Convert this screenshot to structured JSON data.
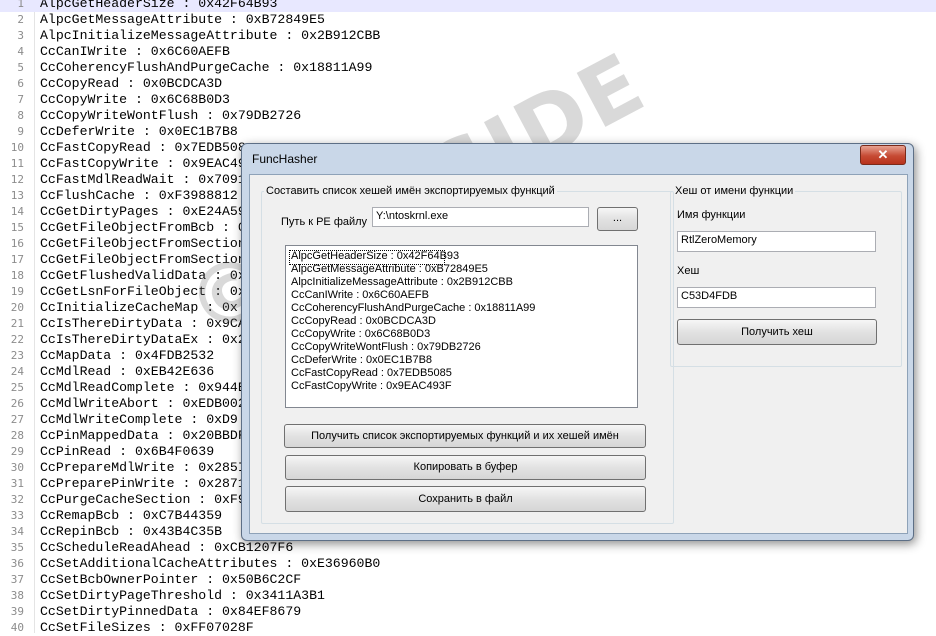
{
  "editor": {
    "lines": [
      {
        "n": "1",
        "text": "AlpcGetHeaderSize : 0x42F64B93"
      },
      {
        "n": "2",
        "text": "AlpcGetMessageAttribute : 0xB72849E5"
      },
      {
        "n": "3",
        "text": "AlpcInitializeMessageAttribute : 0x2B912CBB"
      },
      {
        "n": "4",
        "text": "CcCanIWrite : 0x6C60AEFB"
      },
      {
        "n": "5",
        "text": "CcCoherencyFlushAndPurgeCache : 0x18811A99"
      },
      {
        "n": "6",
        "text": "CcCopyRead : 0x0BCDCA3D"
      },
      {
        "n": "7",
        "text": "CcCopyWrite : 0x6C68B0D3"
      },
      {
        "n": "8",
        "text": "CcCopyWriteWontFlush : 0x79DB2726"
      },
      {
        "n": "9",
        "text": "CcDeferWrite : 0x0EC1B7B8"
      },
      {
        "n": "10",
        "text": "CcFastCopyRead : 0x7EDB508"
      },
      {
        "n": "11",
        "text": "CcFastCopyWrite : 0x9EAC49"
      },
      {
        "n": "12",
        "text": "CcFastMdlReadWait : 0x7091"
      },
      {
        "n": "13",
        "text": "CcFlushCache : 0xF3988812"
      },
      {
        "n": "14",
        "text": "CcGetDirtyPages : 0xE24A59"
      },
      {
        "n": "15",
        "text": "CcGetFileObjectFromBcb : 0"
      },
      {
        "n": "16",
        "text": "CcGetFileObjectFromSection"
      },
      {
        "n": "17",
        "text": "CcGetFileObjectFromSection"
      },
      {
        "n": "18",
        "text": "CcGetFlushedValidData : 0x"
      },
      {
        "n": "19",
        "text": "CcGetLsnForFileObject : 0x"
      },
      {
        "n": "20",
        "text": "CcInitializeCacheMap : 0x"
      },
      {
        "n": "21",
        "text": "CcIsThereDirtyData : 0x9CA"
      },
      {
        "n": "22",
        "text": "CcIsThereDirtyDataEx : 0x2"
      },
      {
        "n": "23",
        "text": "CcMapData : 0x4FDB2532"
      },
      {
        "n": "24",
        "text": "CcMdlRead : 0xEB42E636"
      },
      {
        "n": "25",
        "text": "CcMdlReadComplete : 0x944B"
      },
      {
        "n": "26",
        "text": "CcMdlWriteAbort : 0xEDB002"
      },
      {
        "n": "27",
        "text": "CcMdlWriteComplete : 0xD9"
      },
      {
        "n": "28",
        "text": "CcPinMappedData : 0x20BBDF"
      },
      {
        "n": "29",
        "text": "CcPinRead : 0x6B4F0639"
      },
      {
        "n": "30",
        "text": "CcPrepareMdlWrite : 0x285I"
      },
      {
        "n": "31",
        "text": "CcPreparePinWrite : 0x2871"
      },
      {
        "n": "32",
        "text": "CcPurgeCacheSection : 0xF9"
      },
      {
        "n": "33",
        "text": "CcRemapBcb : 0xC7B44359"
      },
      {
        "n": "34",
        "text": "CcRepinBcb : 0x43B4C35B"
      },
      {
        "n": "35",
        "text": "CcScheduleReadAhead : 0xCB1207F6"
      },
      {
        "n": "36",
        "text": "CcSetAdditionalCacheAttributes : 0xE36960B0"
      },
      {
        "n": "37",
        "text": "CcSetBcbOwnerPointer : 0x50B6C2CF"
      },
      {
        "n": "38",
        "text": "CcSetDirtyPageThreshold : 0x3411A3B1"
      },
      {
        "n": "39",
        "text": "CcSetDirtyPinnedData : 0x84EF8679"
      },
      {
        "n": "40",
        "text": "CcSetFileSizes : 0xFF07028F"
      }
    ]
  },
  "watermark": "©DEFSIDE",
  "window": {
    "title": "FuncHasher",
    "close_glyph": "✕",
    "left_group": {
      "legend": "Составить список хешей имён экспортируемых функций",
      "pe_label": "Путь к PE файлу",
      "pe_path": "Y:\\ntoskrnl.exe",
      "browse_label": "...",
      "list": [
        "AlpcGetHeaderSize : 0x42F64B93",
        "AlpcGetMessageAttribute : 0xB72849E5",
        "AlpcInitializeMessageAttribute : 0x2B912CBB",
        "CcCanIWrite : 0x6C60AEFB",
        "CcCoherencyFlushAndPurgeCache : 0x18811A99",
        "CcCopyRead : 0x0BCDCA3D",
        "CcCopyWrite : 0x6C68B0D3",
        "CcCopyWriteWontFlush : 0x79DB2726",
        "CcDeferWrite : 0x0EC1B7B8",
        "CcFastCopyRead : 0x7EDB5085",
        "CcFastCopyWrite : 0x9EAC493F"
      ],
      "get_list_button": "Получить список экспортируемых функций и их хешей имён",
      "copy_button": "Копировать в буфер",
      "save_button": "Сохранить в файл"
    },
    "right_group": {
      "legend": "Хеш от имени функции",
      "func_label": "Имя функции",
      "func_value": "RtlZeroMemory",
      "hash_label": "Хеш",
      "hash_value": "C53D4FDB",
      "get_hash_button": "Получить хеш"
    }
  }
}
